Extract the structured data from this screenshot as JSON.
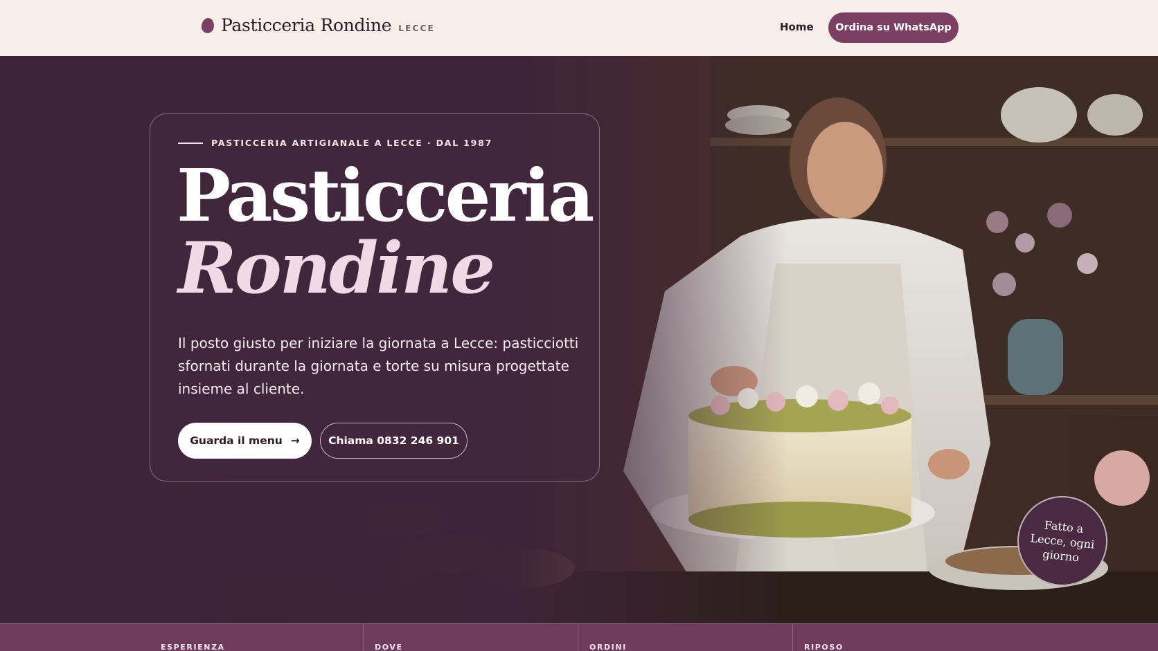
{
  "header": {
    "brand_name": "Pasticceria Rondine",
    "brand_city": "LECCE",
    "nav_home": "Home",
    "cta_whatsapp": "Ordina su WhatsApp"
  },
  "hero": {
    "eyebrow": "PASTICCERIA ARTIGIANALE A LECCE · DAL 1987",
    "title_line1": "Pasticceria",
    "title_line2": "Rondine",
    "lead": "Il posto giusto per iniziare la giornata a Lecce: pasticciotti sfornati durante la giornata e torte su misura progettate insieme al cliente.",
    "btn_menu": "Guarda il menu",
    "btn_menu_icon": "→",
    "btn_call": "Chiama 0832 246 901",
    "badge": "Fatto a Lecce, ogni giorno"
  },
  "strip": {
    "labels": [
      "ESPERIENZA",
      "DOVE",
      "ORDINI",
      "RIPOSO"
    ]
  },
  "colors": {
    "plum": "#7b3f63",
    "deep_plum": "#3d2638",
    "cream": "#f7eee9",
    "pink_accent": "#f1d9e6"
  }
}
